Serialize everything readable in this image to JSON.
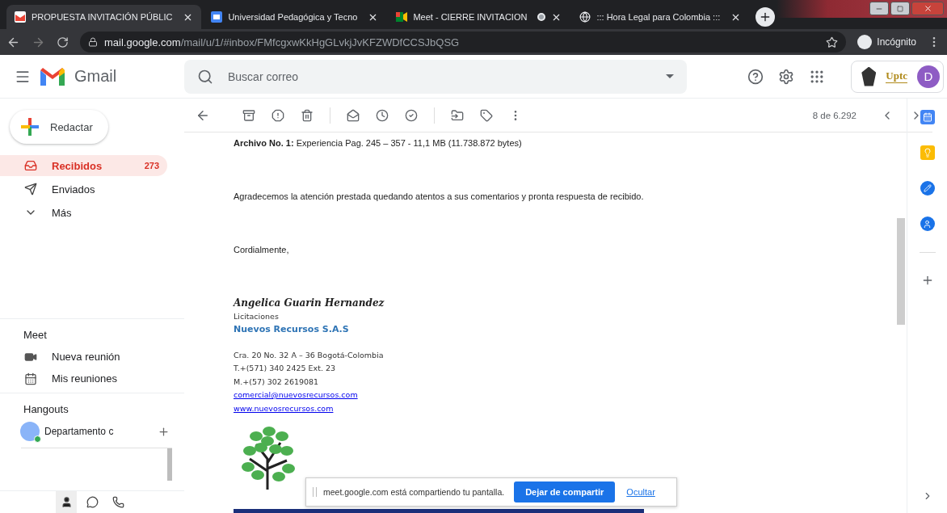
{
  "browser": {
    "tabs": [
      {
        "title": "PROPUESTA INVITACIÓN PÚBLIC",
        "selected": true,
        "recording": false
      },
      {
        "title": "Universidad Pedagógica y Tecno",
        "selected": false,
        "recording": false
      },
      {
        "title": "Meet - CIERRE INVITACION",
        "selected": false,
        "recording": true
      },
      {
        "title": "::: Hora Legal para Colombia :::",
        "selected": false,
        "recording": false
      }
    ],
    "address": {
      "host": "mail.google.com",
      "path": "/mail/u/1/#inbox/FMfcgxwKkHgGLvkjJvKFZWDfCCSJbQSG"
    },
    "profile": "Incógnito"
  },
  "header": {
    "app_name": "Gmail",
    "search": {
      "placeholder": "Buscar correo"
    },
    "org_logo": "Uptc",
    "avatar": "D"
  },
  "sidebar": {
    "compose": "Redactar",
    "items": [
      {
        "label": "Recibidos",
        "count": "273",
        "selected": true
      },
      {
        "label": "Enviados",
        "selected": false
      },
      {
        "label": "Más",
        "selected": false
      }
    ],
    "meet": {
      "title": "Meet",
      "items": [
        {
          "label": "Nueva reunión"
        },
        {
          "label": "Mis reuniones"
        }
      ]
    },
    "hangouts": {
      "title": "Hangouts",
      "contacts": [
        {
          "name": "Departamento c",
          "online": true
        }
      ]
    }
  },
  "toolbar": {
    "pager": "8 de 6.292"
  },
  "message": {
    "attachment": {
      "label": "Archivo No. 1:",
      "text": "Experiencia Pag. 245 – 357 -  11,1 MB (11.738.872 bytes)"
    },
    "thanks": "Agradecemos la atención prestada quedando atentos a sus comentarios y pronta respuesta de recibido.",
    "closing": "Cordialmente,",
    "signature": {
      "name": "Angelica Guarin Hernandez",
      "role": "Licitaciones",
      "company": "Nuevos Recursos S.A.S",
      "lines": [
        "Cra. 20 No. 32 A – 36 Bogotá-Colombia",
        "T.+(571) 340 2425 Ext. 23",
        "M.+(57)  302 2619081"
      ],
      "links": [
        "comercial@nuevosrecursos.com",
        "www.nuevosrecursos.com"
      ]
    }
  },
  "share_bar": {
    "message": "meet.google.com está compartiendo tu pantalla.",
    "stop_button": "Dejar de compartir",
    "hide_link": "Ocultar"
  }
}
